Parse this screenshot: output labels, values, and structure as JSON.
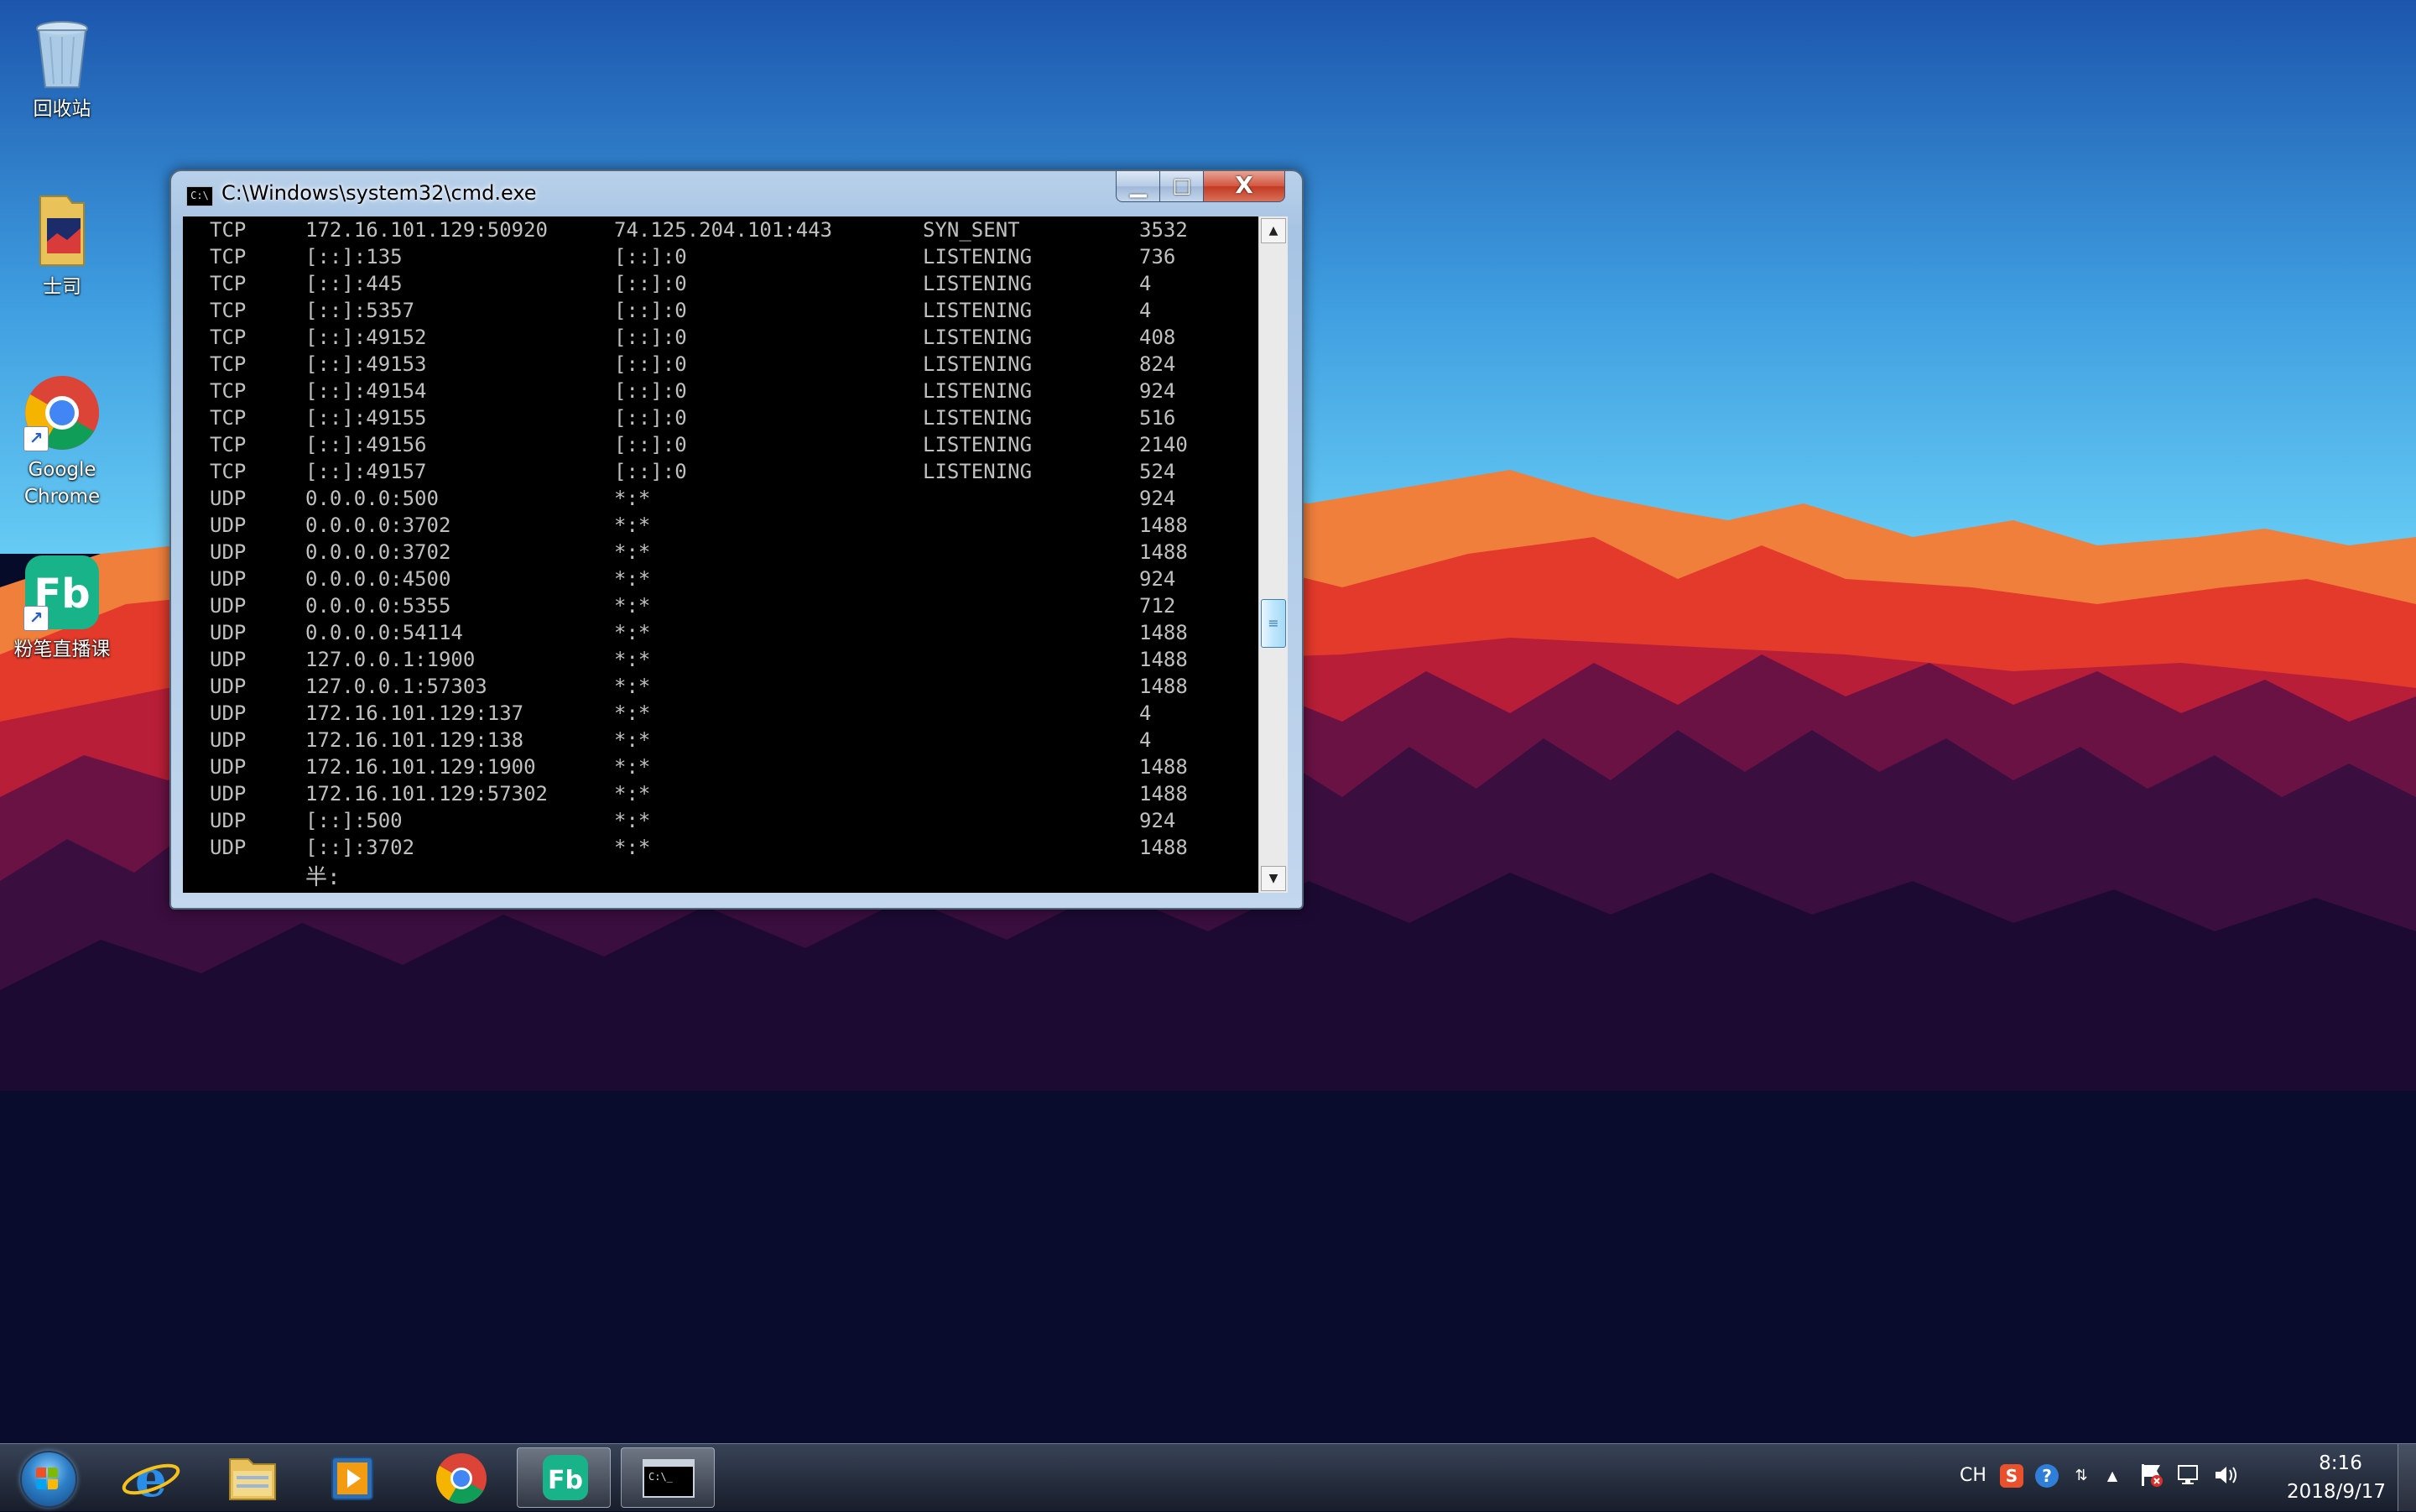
{
  "desktop": {
    "icons": [
      {
        "label": "回收站",
        "icon": "recycle-bin-icon"
      },
      {
        "label": "士司",
        "icon": "folder-icon"
      },
      {
        "label": "Google Chrome",
        "icon": "chrome-icon"
      },
      {
        "label": "粉笔直播课",
        "icon": "fenbi-icon"
      }
    ]
  },
  "window": {
    "title": "C:\\Windows\\system32\\cmd.exe",
    "icon": "cmd-icon",
    "icon_text": "C:\\",
    "minimize_glyph": "▁",
    "maximize_glyph": "□",
    "close_glyph": "X"
  },
  "console": {
    "rows": [
      {
        "proto": "TCP",
        "local": "172.16.101.129:50920",
        "foreign": "74.125.204.101:443",
        "state": "SYN_SENT",
        "pid": "3532"
      },
      {
        "proto": "TCP",
        "local": "[::]:135",
        "foreign": "[::]:0",
        "state": "LISTENING",
        "pid": "736"
      },
      {
        "proto": "TCP",
        "local": "[::]:445",
        "foreign": "[::]:0",
        "state": "LISTENING",
        "pid": "4"
      },
      {
        "proto": "TCP",
        "local": "[::]:5357",
        "foreign": "[::]:0",
        "state": "LISTENING",
        "pid": "4"
      },
      {
        "proto": "TCP",
        "local": "[::]:49152",
        "foreign": "[::]:0",
        "state": "LISTENING",
        "pid": "408"
      },
      {
        "proto": "TCP",
        "local": "[::]:49153",
        "foreign": "[::]:0",
        "state": "LISTENING",
        "pid": "824"
      },
      {
        "proto": "TCP",
        "local": "[::]:49154",
        "foreign": "[::]:0",
        "state": "LISTENING",
        "pid": "924"
      },
      {
        "proto": "TCP",
        "local": "[::]:49155",
        "foreign": "[::]:0",
        "state": "LISTENING",
        "pid": "516"
      },
      {
        "proto": "TCP",
        "local": "[::]:49156",
        "foreign": "[::]:0",
        "state": "LISTENING",
        "pid": "2140"
      },
      {
        "proto": "TCP",
        "local": "[::]:49157",
        "foreign": "[::]:0",
        "state": "LISTENING",
        "pid": "524"
      },
      {
        "proto": "UDP",
        "local": "0.0.0.0:500",
        "foreign": "*:*",
        "state": "",
        "pid": "924"
      },
      {
        "proto": "UDP",
        "local": "0.0.0.0:3702",
        "foreign": "*:*",
        "state": "",
        "pid": "1488"
      },
      {
        "proto": "UDP",
        "local": "0.0.0.0:3702",
        "foreign": "*:*",
        "state": "",
        "pid": "1488"
      },
      {
        "proto": "UDP",
        "local": "0.0.0.0:4500",
        "foreign": "*:*",
        "state": "",
        "pid": "924"
      },
      {
        "proto": "UDP",
        "local": "0.0.0.0:5355",
        "foreign": "*:*",
        "state": "",
        "pid": "712"
      },
      {
        "proto": "UDP",
        "local": "0.0.0.0:54114",
        "foreign": "*:*",
        "state": "",
        "pid": "1488"
      },
      {
        "proto": "UDP",
        "local": "127.0.0.1:1900",
        "foreign": "*:*",
        "state": "",
        "pid": "1488"
      },
      {
        "proto": "UDP",
        "local": "127.0.0.1:57303",
        "foreign": "*:*",
        "state": "",
        "pid": "1488"
      },
      {
        "proto": "UDP",
        "local": "172.16.101.129:137",
        "foreign": "*:*",
        "state": "",
        "pid": "4"
      },
      {
        "proto": "UDP",
        "local": "172.16.101.129:138",
        "foreign": "*:*",
        "state": "",
        "pid": "4"
      },
      {
        "proto": "UDP",
        "local": "172.16.101.129:1900",
        "foreign": "*:*",
        "state": "",
        "pid": "1488"
      },
      {
        "proto": "UDP",
        "local": "172.16.101.129:57302",
        "foreign": "*:*",
        "state": "",
        "pid": "1488"
      },
      {
        "proto": "UDP",
        "local": "[::]:500",
        "foreign": "*:*",
        "state": "",
        "pid": "924"
      },
      {
        "proto": "UDP",
        "local": "[::]:3702",
        "foreign": "*:*",
        "state": "",
        "pid": "1488"
      }
    ],
    "ime_prompt": "半:"
  },
  "scrollbar": {
    "up_glyph": "▲",
    "down_glyph": "▼",
    "thumb_glyph": "≡",
    "position_fraction": 0.62
  },
  "taskbar": {
    "start_icon": "windows-start-icon",
    "buttons": [
      {
        "icon": "internet-explorer-icon",
        "active": false
      },
      {
        "icon": "file-explorer-icon",
        "active": false
      },
      {
        "icon": "media-player-icon",
        "active": false
      },
      {
        "icon": "chrome-icon",
        "active": false
      },
      {
        "icon": "fenbi-icon",
        "active": true
      },
      {
        "icon": "cmd-icon",
        "active": true
      }
    ],
    "tray": {
      "language": "CH",
      "sogou_icon": "S",
      "help_icon": "?",
      "clock_time": "8:16",
      "clock_date": "2018/9/17"
    }
  },
  "colors": {
    "sky_top": "#1f5fb3",
    "sky_bottom": "#59c4f2",
    "mountain_red": "#e0302a",
    "console_bg": "#000000",
    "console_fg": "#c0c0c0",
    "fenbi_green": "#19b38a"
  }
}
